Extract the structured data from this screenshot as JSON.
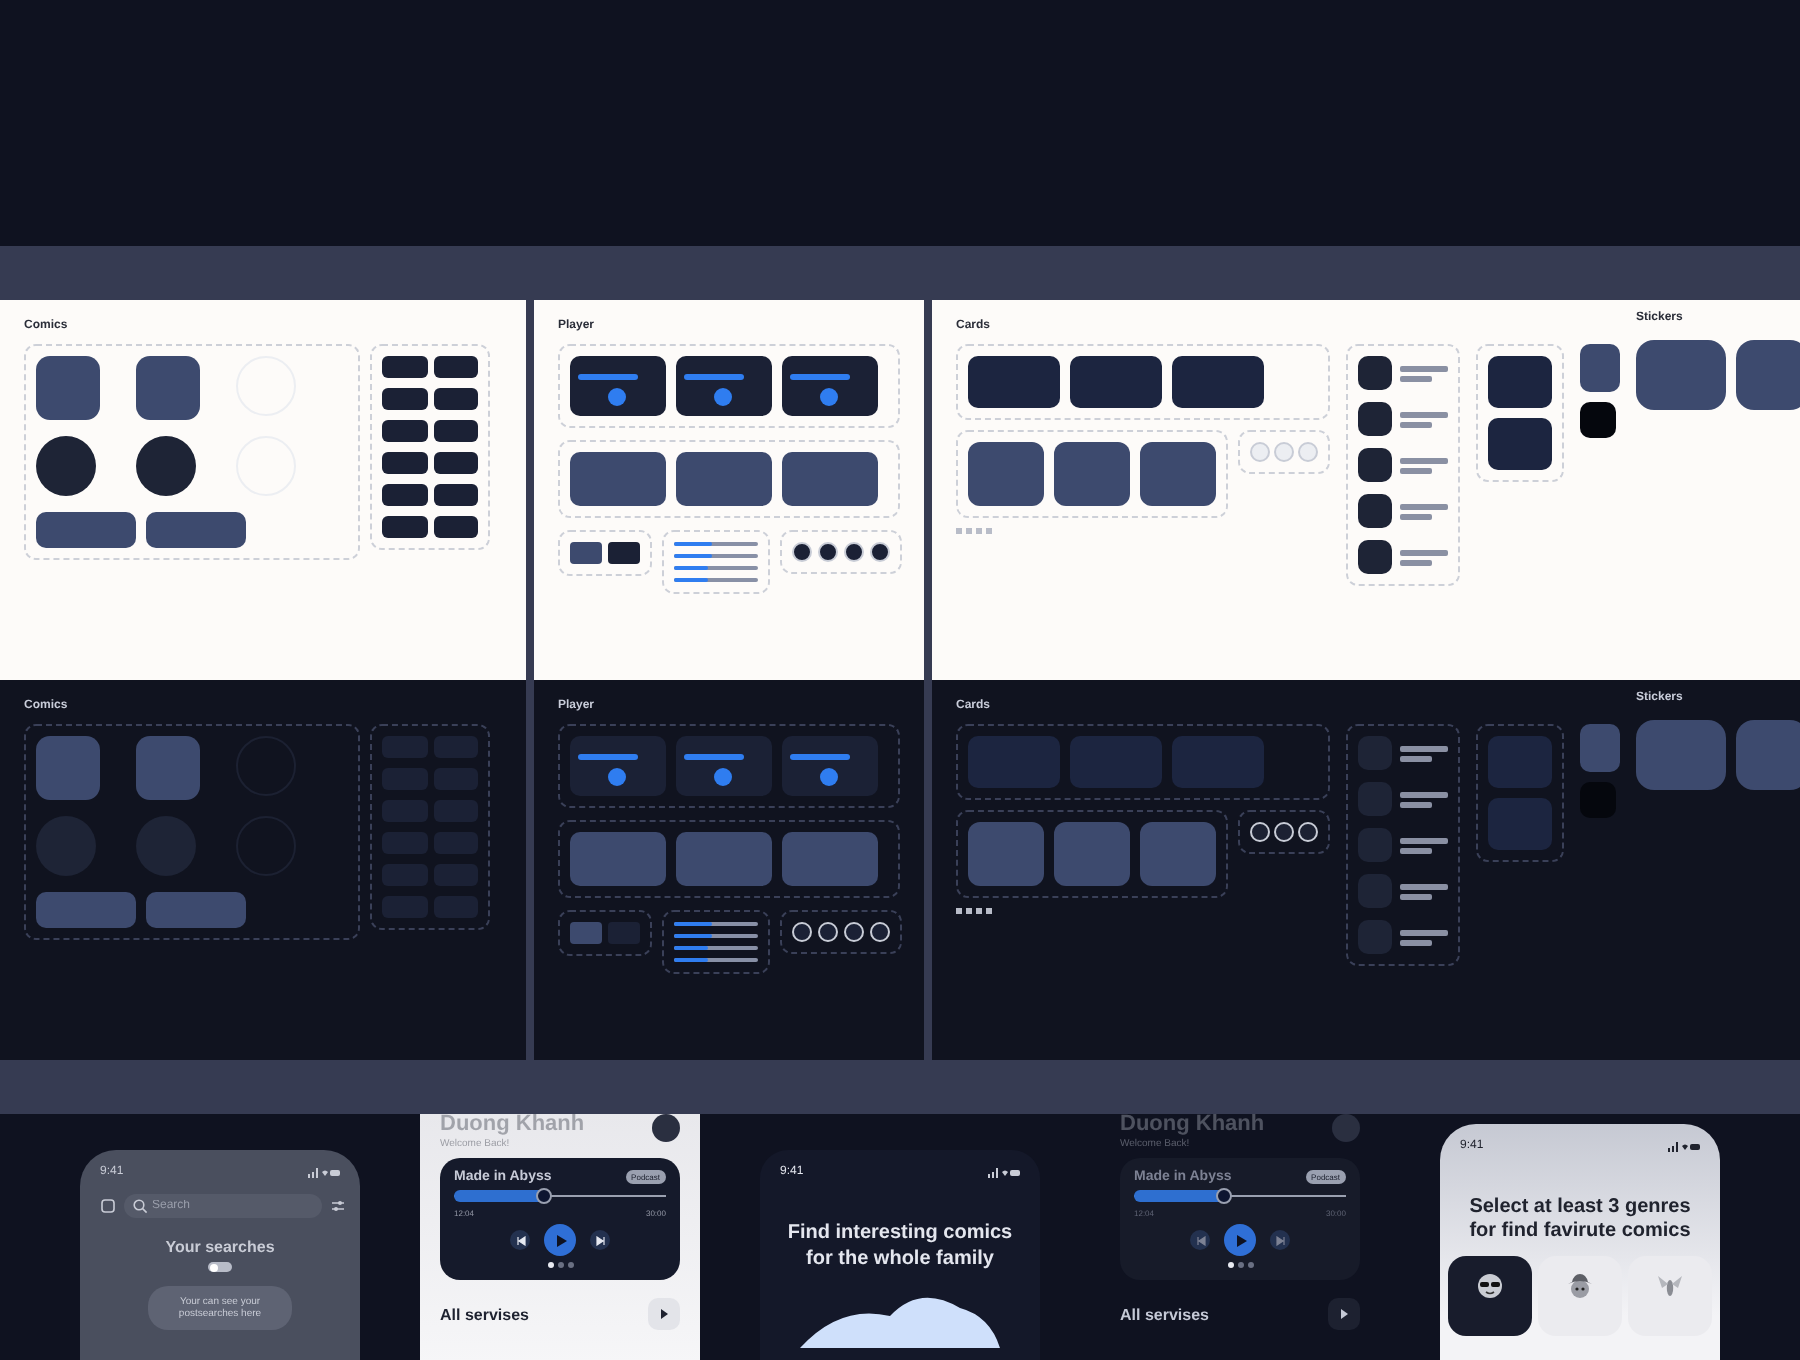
{
  "boards": [
    {
      "dark_mode": false,
      "panels": [
        {
          "kind": "comics",
          "title": "Comics"
        },
        {
          "kind": "player",
          "title": "Player",
          "sliders": [
            {
              "level": 0.45
            },
            {
              "level": 0.45
            },
            {
              "level": 0.4
            },
            {
              "level": 0.4
            }
          ]
        },
        {
          "kind": "cards",
          "title": "Cards",
          "side_title": "Stickers"
        }
      ]
    },
    {
      "dark_mode": true,
      "panels": [
        {
          "kind": "comics",
          "title": "Comics"
        },
        {
          "kind": "player",
          "title": "Player",
          "sliders": [
            {
              "level": 0.45
            },
            {
              "level": 0.45
            },
            {
              "level": 0.4
            },
            {
              "level": 0.4
            }
          ]
        },
        {
          "kind": "cards",
          "title": "Cards",
          "side_title": "Stickers"
        }
      ]
    }
  ],
  "phones": [
    {
      "kind": "search",
      "time": "9:41",
      "search_placeholder": "Search",
      "heading": "Your searches",
      "toggle_on": false,
      "message": "Your can see your postsearches here"
    },
    {
      "kind": "player",
      "dark_mode": false,
      "name": "Duong Khanh",
      "greeting": "Welcome Back!",
      "track": "Made in Abyss",
      "tag": "Podcast",
      "level": 0.42,
      "elapsed": "12:04",
      "total": "30:00",
      "dots": [
        {
          "selected": true
        },
        {
          "selected": false
        },
        {
          "selected": false
        }
      ],
      "section": "All servises"
    },
    {
      "kind": "onboarding",
      "time": "9:41",
      "headline": "Find interesting comics for the whole family"
    },
    {
      "kind": "player",
      "dark_mode": true,
      "name": "Duong Khanh",
      "greeting": "Welcome Back!",
      "track": "Made in Abyss",
      "tag": "Podcast",
      "level": 0.42,
      "elapsed": "12:04",
      "total": "30:00",
      "dots": [
        {
          "selected": true
        },
        {
          "selected": false
        },
        {
          "selected": false
        }
      ],
      "section": "All servises"
    },
    {
      "kind": "genres",
      "time": "9:41",
      "headline": "Select at least 3 genres for find favirute comics",
      "genres": [
        {
          "selected": true
        },
        {
          "selected": false
        },
        {
          "selected": false
        }
      ]
    }
  ]
}
